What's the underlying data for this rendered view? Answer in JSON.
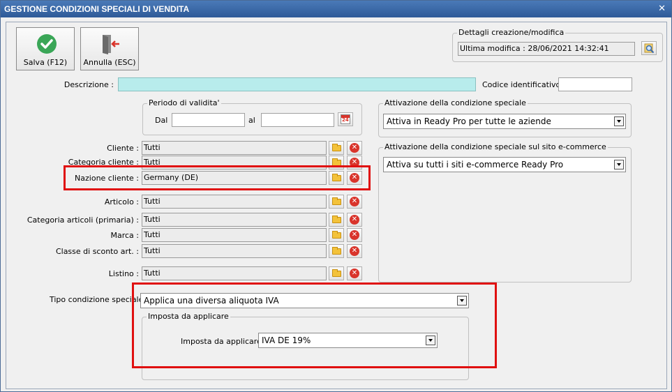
{
  "window": {
    "title": "GESTIONE CONDIZIONI SPECIALI DI VENDITA",
    "close": "✕"
  },
  "toolbar": {
    "save_label": "Salva (F12)",
    "cancel_label": "Annulla (ESC)"
  },
  "details": {
    "group_title": "Dettagli creazione/modifica",
    "last_modified": "Ultima modifica : 28/06/2021  14:32:41"
  },
  "description": {
    "label": "Descrizione :",
    "value": ""
  },
  "code": {
    "label": "Codice identificativo :",
    "value": ""
  },
  "validity": {
    "group_title": "Periodo di validita'",
    "from_label": "Dal",
    "to_label": "al",
    "from_value": "",
    "to_value": "",
    "calendar_day": "24"
  },
  "filters": [
    {
      "label": "Cliente :",
      "value": "Tutti"
    },
    {
      "label": "Categoria cliente :",
      "value": "Tutti"
    },
    {
      "label": "Nazione cliente :",
      "value": "Germany (DE)"
    },
    {
      "label": "Articolo :",
      "value": "Tutti"
    },
    {
      "label": "Categoria articoli (primaria) :",
      "value": "Tutti"
    },
    {
      "label": "Marca :",
      "value": "Tutti"
    },
    {
      "label": "Classe di sconto art. :",
      "value": "Tutti"
    },
    {
      "label": "Listino :",
      "value": "Tutti"
    }
  ],
  "activation": {
    "group_title": "Attivazione della condizione speciale",
    "value": "Attiva in Ready Pro per tutte le aziende"
  },
  "activation_ecom": {
    "group_title": "Attivazione della condizione speciale sul sito e-commerce",
    "value": "Attiva su tutti i siti e-commerce Ready Pro"
  },
  "special": {
    "label": "Tipo condizione speciale",
    "value": "Applica una diversa aliquota IVA"
  },
  "tax": {
    "group_title": "Imposta da applicare",
    "label": "Imposta da applicare :",
    "value": "IVA DE 19%"
  },
  "colors": {
    "title_bar": "#2e5a98",
    "highlight": "#e01010",
    "description_bg": "#b8ecec"
  }
}
